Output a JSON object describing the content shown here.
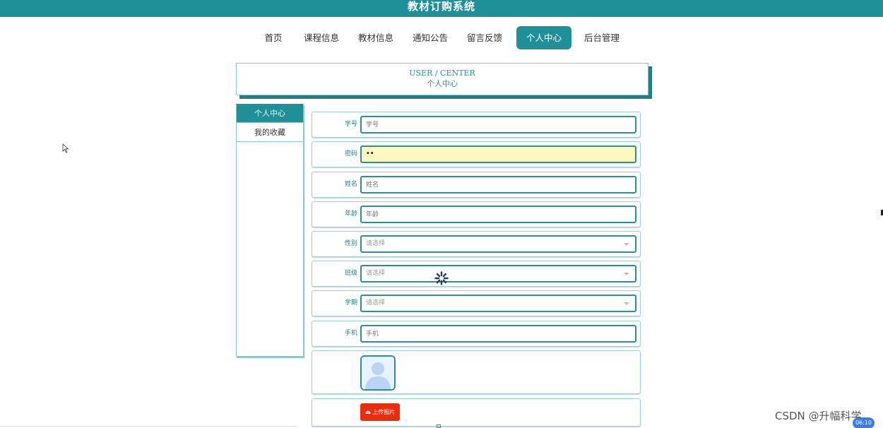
{
  "app": {
    "title": "教材订购系统"
  },
  "nav": {
    "items": [
      {
        "label": "首页"
      },
      {
        "label": "课程信息"
      },
      {
        "label": "教材信息"
      },
      {
        "label": "通知公告"
      },
      {
        "label": "留言反馈"
      },
      {
        "label": "个人中心"
      },
      {
        "label": "后台管理"
      }
    ],
    "active_index": 5
  },
  "header": {
    "en": "USER / CENTER",
    "zh": "个人中心"
  },
  "sidebar": {
    "items": [
      {
        "label": "个人中心"
      },
      {
        "label": "我的收藏"
      }
    ],
    "active_index": 0
  },
  "form": {
    "student_id": {
      "label": "学号",
      "placeholder": "学号",
      "value": ""
    },
    "password": {
      "label": "密码",
      "value": "••"
    },
    "name": {
      "label": "姓名",
      "placeholder": "姓名",
      "value": ""
    },
    "age": {
      "label": "年龄",
      "placeholder": "年龄",
      "value": ""
    },
    "gender": {
      "label": "性别",
      "selected": "请选择"
    },
    "class": {
      "label": "班级",
      "selected": "请选择"
    },
    "semester": {
      "label": "学期",
      "selected": "请选择"
    },
    "phone": {
      "label": "手机",
      "placeholder": "手机",
      "value": ""
    },
    "upload_label": "上传图片"
  },
  "overlay": {
    "watermark": "CSDN @升幅科学",
    "time": "06:10"
  },
  "colors": {
    "primary": "#1f8f98",
    "field_border": "#2b8f98",
    "upload": "#ee2b0c",
    "highlight_field": "#fbf8c4"
  },
  "icons": {
    "spinner": "loading-spinner-icon",
    "avatar": "avatar-placeholder-icon",
    "upload": "cloud-upload-icon",
    "cursor": "mouse-pointer-icon"
  }
}
